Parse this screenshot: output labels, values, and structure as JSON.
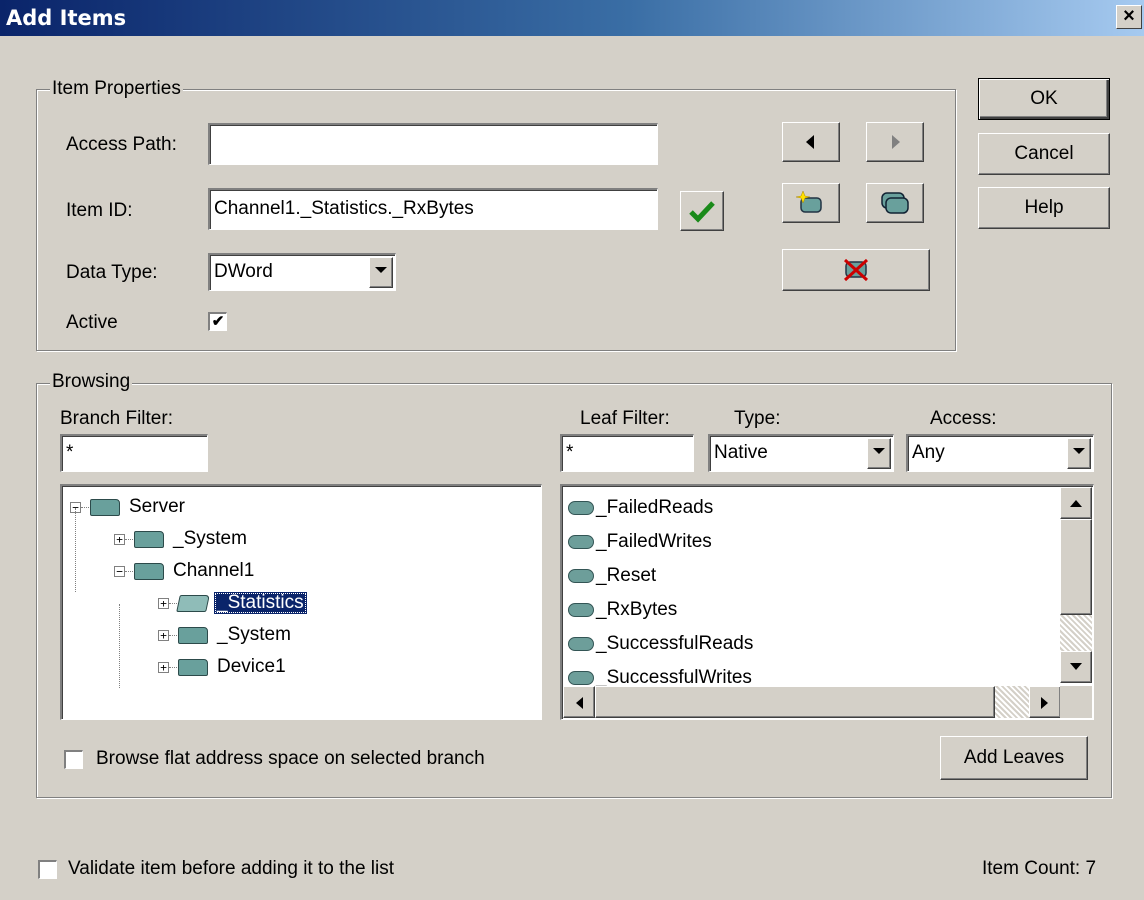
{
  "window": {
    "title": "Add Items",
    "close_glyph": "×"
  },
  "item_properties": {
    "legend": "Item Properties",
    "access_path": {
      "label": "Access Path:",
      "value": ""
    },
    "item_id": {
      "label": "Item ID:",
      "value": "Channel1._Statistics._RxBytes"
    },
    "data_type": {
      "label": "Data Type:",
      "value": "DWord"
    },
    "active": {
      "label": "Active",
      "checked": true,
      "check_glyph": "✔"
    }
  },
  "buttons": {
    "ok": "OK",
    "cancel": "Cancel",
    "help": "Help",
    "add_leaves": "Add Leaves"
  },
  "icons": {
    "validate": "checkmark-icon",
    "prev": "arrow-left-icon",
    "next": "arrow-right-icon",
    "new_item": "new-item-icon",
    "duplicate": "duplicate-item-icon",
    "delete": "delete-item-icon"
  },
  "browsing": {
    "legend": "Browsing",
    "branch_filter": {
      "label": "Branch Filter:",
      "value": "*"
    },
    "leaf_filter": {
      "label": "Leaf Filter:",
      "value": "*"
    },
    "type": {
      "label": "Type:",
      "value": "Native"
    },
    "access": {
      "label": "Access:",
      "value": "Any"
    },
    "tree": [
      {
        "label": "Server",
        "depth": 0,
        "expander": "−",
        "selected": false
      },
      {
        "label": "_System",
        "depth": 1,
        "expander": "+",
        "selected": false
      },
      {
        "label": "Channel1",
        "depth": 1,
        "expander": "−",
        "selected": false
      },
      {
        "label": "_Statistics",
        "depth": 2,
        "expander": "+",
        "selected": true
      },
      {
        "label": "_System",
        "depth": 2,
        "expander": "+",
        "selected": false
      },
      {
        "label": "Device1",
        "depth": 2,
        "expander": "+",
        "selected": false
      }
    ],
    "leaves": [
      "_FailedReads",
      "_FailedWrites",
      "_Reset",
      "_RxBytes",
      "_SuccessfulReads",
      "_SuccessfulWrites"
    ],
    "flat_browse_label": "Browse flat address space on selected branch",
    "flat_browse_checked": false
  },
  "footer": {
    "validate_label": "Validate item before adding it to the list",
    "validate_checked": false,
    "item_count": "Item Count: 7"
  },
  "colors": {
    "title_start": "#0a246a",
    "selection": "#0a246a",
    "face": "#d4d0c8"
  }
}
